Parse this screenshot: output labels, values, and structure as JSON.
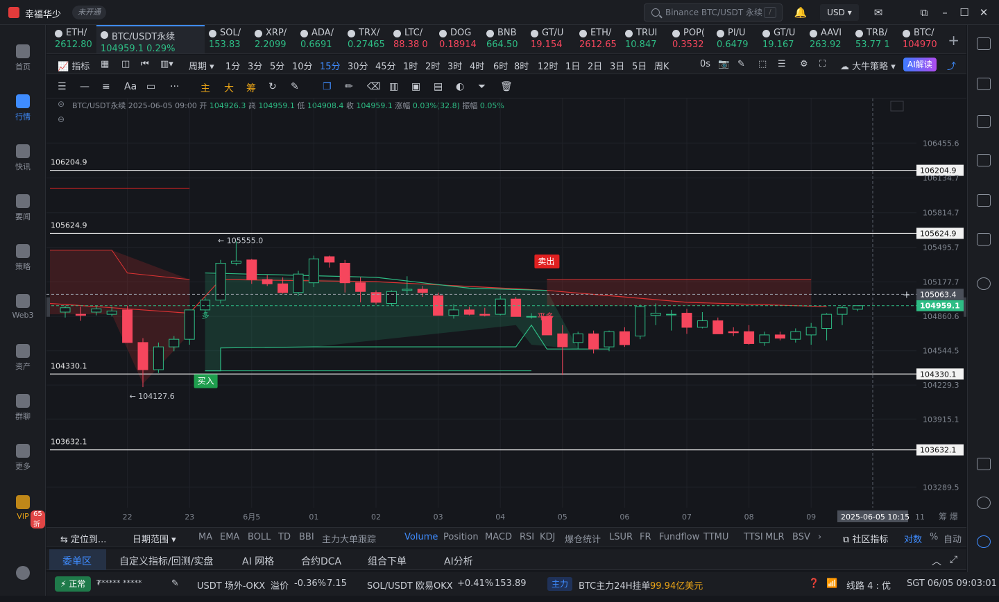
{
  "app": {
    "name": "幸福华少",
    "status": "未开通"
  },
  "search": {
    "placeholder": "Binance BTC/USDT 永续",
    "key": "/"
  },
  "currency": "USD",
  "sidebar": {
    "items": [
      {
        "label": "首页",
        "icon": "home-icon"
      },
      {
        "label": "行情",
        "icon": "chart-bars-icon",
        "active": true
      },
      {
        "label": "快讯",
        "icon": "news-icon"
      },
      {
        "label": "要闻",
        "icon": "article-icon"
      },
      {
        "label": "策略",
        "icon": "robot-icon"
      },
      {
        "label": "Web3",
        "icon": "web3-icon"
      },
      {
        "label": "资产",
        "icon": "wallet-icon"
      },
      {
        "label": "群聊",
        "icon": "chat-icon"
      },
      {
        "label": "更多",
        "icon": "grid-icon"
      }
    ],
    "vip": {
      "label": "VIP",
      "discount": "65折"
    }
  },
  "tickers": [
    {
      "sym": "ETH/",
      "price": "2612.80",
      "dir": "up"
    },
    {
      "sym": "BTC/USDT永续",
      "price": "104959.1  0.29%",
      "dir": "up",
      "active": true
    },
    {
      "sym": "SOL/",
      "price": "153.83",
      "dir": "up"
    },
    {
      "sym": "XRP/",
      "price": "2.2099",
      "dir": "up"
    },
    {
      "sym": "ADA/",
      "price": "0.6691",
      "dir": "up"
    },
    {
      "sym": "TRX/",
      "price": "0.27465",
      "dir": "up"
    },
    {
      "sym": "LTC/",
      "price": "88.38 0",
      "dir": "dn"
    },
    {
      "sym": "DOG",
      "price": "0.18914",
      "dir": "dn"
    },
    {
      "sym": "BNB",
      "price": "664.50",
      "dir": "up"
    },
    {
      "sym": "GT/U",
      "price": "19.154",
      "dir": "dn"
    },
    {
      "sym": "ETH/",
      "price": "2612.65",
      "dir": "dn"
    },
    {
      "sym": "TRUI",
      "price": "10.847",
      "dir": "up"
    },
    {
      "sym": "POP(",
      "price": "0.3532",
      "dir": "dn"
    },
    {
      "sym": "PI/U",
      "price": "0.6479",
      "dir": "up"
    },
    {
      "sym": "GT/U",
      "price": "19.167",
      "dir": "up"
    },
    {
      "sym": "AAVI",
      "price": "263.92",
      "dir": "up"
    },
    {
      "sym": "TRB/",
      "price": "53.77 1",
      "dir": "up"
    },
    {
      "sym": "BTC/",
      "price": "104970",
      "dir": "dn"
    }
  ],
  "intervals": {
    "indicator": "指标",
    "period": "周期",
    "list": [
      "1分",
      "3分",
      "5分",
      "10分",
      "15分",
      "30分",
      "45分",
      "1时",
      "2时",
      "3时",
      "4时",
      "6时",
      "8时",
      "12时",
      "1日",
      "2日",
      "3日",
      "5日",
      "周K"
    ],
    "selected": "15分",
    "countdown": "0s",
    "strategy": "大牛策略",
    "ai": "AI解读"
  },
  "drawtools": {
    "main": "主",
    "big": "大",
    "chip": "筹"
  },
  "chart_info": {
    "symbol": "BTC/USDT永续",
    "time": "2025-06-05 09:00",
    "open_label": "开",
    "open": "104926.3",
    "high_label": "高",
    "high": "104959.1",
    "low_label": "低",
    "low": "104908.4",
    "close_label": "收",
    "close": "104959.1",
    "chg_label": "涨幅",
    "chg": "0.03%(32.8)",
    "amp_label": "振幅",
    "amp": "0.05%"
  },
  "chart_data": {
    "type": "candlestick",
    "ylim": [
      103100,
      106700
    ],
    "yticks": [
      106455.6,
      106134.7,
      105814.7,
      105495.7,
      105177.7,
      104860.6,
      104544.5,
      104229.3,
      103915.1,
      103289.5
    ],
    "xticks": [
      "22",
      "23",
      "6月5",
      "01",
      "02",
      "03",
      "04",
      "05",
      "06",
      "07",
      "08",
      "09"
    ],
    "candles": [
      [
        104900,
        104960,
        104850,
        104940
      ],
      [
        104880,
        104950,
        104820,
        104870
      ],
      [
        104900,
        104960,
        104870,
        104930
      ],
      [
        104880,
        104950,
        104860,
        104910
      ],
      [
        104920,
        104960,
        104620,
        104620
      ],
      [
        104620,
        104660,
        104210,
        104370
      ],
      [
        104370,
        104620,
        104340,
        104580
      ],
      [
        104580,
        104680,
        104540,
        104650
      ],
      [
        104650,
        104920,
        104600,
        104920
      ],
      [
        104920,
        105040,
        104880,
        105010
      ],
      [
        105010,
        105380,
        104980,
        105350
      ],
      [
        105350,
        105555,
        105330,
        105370
      ],
      [
        105380,
        105390,
        105160,
        105200
      ],
      [
        105200,
        105240,
        105140,
        105160
      ],
      [
        105160,
        105220,
        105070,
        105080
      ],
      [
        105080,
        105280,
        105050,
        105250
      ],
      [
        105170,
        105420,
        105130,
        105390
      ],
      [
        105410,
        105420,
        105310,
        105360
      ],
      [
        105350,
        105380,
        105080,
        105170
      ],
      [
        105170,
        105220,
        104990,
        105090
      ],
      [
        105080,
        105100,
        104970,
        104990
      ],
      [
        104980,
        105100,
        104960,
        105090
      ],
      [
        105100,
        105230,
        105060,
        105110
      ],
      [
        105110,
        105140,
        105040,
        105080
      ],
      [
        105050,
        105080,
        104870,
        104870
      ],
      [
        104870,
        104970,
        104840,
        104920
      ],
      [
        104920,
        104950,
        104870,
        104880
      ],
      [
        104880,
        104940,
        104860,
        104870
      ],
      [
        104880,
        105050,
        104870,
        105020
      ],
      [
        105020,
        105040,
        104860,
        104860
      ],
      [
        104860,
        104890,
        104840,
        104860
      ],
      [
        104860,
        104880,
        104690,
        104690
      ],
      [
        104700,
        104780,
        104320,
        104580
      ],
      [
        104620,
        104720,
        104560,
        104700
      ],
      [
        104700,
        104730,
        104520,
        104560
      ],
      [
        104580,
        104730,
        104540,
        104720
      ],
      [
        104720,
        104760,
        104580,
        104600
      ],
      [
        104680,
        104970,
        104650,
        104950
      ],
      [
        104870,
        104980,
        104780,
        104890
      ],
      [
        104880,
        104920,
        104730,
        104880
      ],
      [
        104890,
        104930,
        104700,
        104760
      ],
      [
        104760,
        104900,
        104750,
        104820
      ],
      [
        104820,
        104850,
        104700,
        104700
      ],
      [
        104720,
        104760,
        104680,
        104710
      ],
      [
        104720,
        104780,
        104600,
        104610
      ],
      [
        104620,
        104720,
        104590,
        104690
      ],
      [
        104690,
        104720,
        104640,
        104660
      ],
      [
        104650,
        104750,
        104620,
        104720
      ],
      [
        104690,
        104800,
        104600,
        104760
      ],
      [
        104750,
        104890,
        104640,
        104880
      ],
      [
        104880,
        104960,
        104780,
        104940
      ],
      [
        104926.3,
        104959.1,
        104908.4,
        104959.1
      ]
    ],
    "hlines": [
      106204.9,
      105624.9,
      104330.1,
      103632.1
    ],
    "tags": {
      "current": "104959.1",
      "cursor": "105063.4",
      "cursor_time": "2025-06-05 10:15"
    },
    "annotations": {
      "max": "105555.0",
      "min": "104127.6",
      "buy": "买入",
      "sell": "卖出",
      "flat": "平多",
      "long": "多"
    }
  },
  "indicator_bar": {
    "locate": "定位到...",
    "range": "日期范围",
    "items": [
      "MA",
      "EMA",
      "BOLL",
      "TD",
      "BBI",
      "主力大单跟踪",
      "Volume",
      "Position",
      "MACD",
      "RSI",
      "KDJ",
      "爆仓统计",
      "LSUR",
      "FR",
      "Fundflow",
      "TTMU",
      "TTSI",
      "MLR",
      "BSV"
    ],
    "selected": "Volume",
    "community": "社区指标",
    "log": "对数",
    "pct": "%",
    "auto": "自动"
  },
  "bottom_tabs": [
    "委单区",
    "自定义指标/回测/实盘",
    "AI 网格",
    "合约DCA",
    "组合下单",
    "AI分析"
  ],
  "status": {
    "ok": "正常",
    "masked": "₮*****  *****",
    "okx_label": "USDT 场外-OKX",
    "premium_label": "溢价",
    "premium": "-0.36%",
    "okx_price": "7.15",
    "sol_label": "SOL/USDT 欧易OKX",
    "sol_chg": "+0.41%",
    "sol_price": "153.89",
    "zl": "主力",
    "zl_text": "BTC主力24H挂单",
    "zl_amount": "99.94亿美元",
    "line": "线路 4 : 优",
    "time": "SGT 06/05 09:03:01"
  }
}
